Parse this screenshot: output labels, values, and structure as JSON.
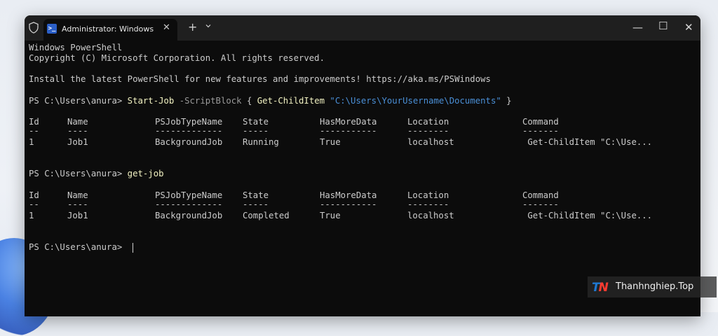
{
  "window": {
    "tab_title": "Administrator: Windows PowerShell",
    "tab_icon_glyph": ">_",
    "new_tab_label": "+",
    "close_tab_label": "✕",
    "minimize_label": "—",
    "maximize_label": "☐",
    "close_label": "✕"
  },
  "terminal": {
    "lines": [
      "Windows PowerShell",
      "Copyright (C) Microsoft Corporation. All rights reserved.",
      "Install the latest PowerShell for new features and improvements! https://aka.ms/PSWindows"
    ],
    "prompt": "PS C:\\Users\\anura> ",
    "command1": {
      "cmdlet": "Start-Job",
      "param": " -ScriptBlock",
      "brace_open": " { ",
      "inner": "Get-ChildItem",
      "string": " \"C:\\Users\\YourUsername\\Documents\"",
      "brace_close": " }"
    },
    "table1": {
      "headers": [
        "Id",
        "Name",
        "PSJobTypeName",
        "State",
        "HasMoreData",
        "Location",
        "Command"
      ],
      "underlines": [
        "--",
        "----",
        "-------------",
        "-----",
        "-----------",
        "--------",
        "-------"
      ],
      "row": [
        "1",
        "Job1",
        "BackgroundJob",
        "Running",
        "True",
        "localhost",
        " Get-ChildItem \"C:\\Use..."
      ]
    },
    "command2": "get-job",
    "table2": {
      "headers": [
        "Id",
        "Name",
        "PSJobTypeName",
        "State",
        "HasMoreData",
        "Location",
        "Command"
      ],
      "underlines": [
        "--",
        "----",
        "-------------",
        "-----",
        "-----------",
        "--------",
        "-------"
      ],
      "row": [
        "1",
        "Job1",
        "BackgroundJob",
        "Completed",
        "True",
        "localhost",
        " Get-ChildItem \"C:\\Use..."
      ]
    }
  },
  "watermark": {
    "logo_t": "T",
    "logo_n": "N",
    "text": "Thanhnghiep.Top"
  },
  "colors": {
    "terminal_bg": "#0c0c0c",
    "titlebar_bg": "#1f1f1f",
    "cmdlet": "#f2f2c2",
    "parameter": "#9a9a9a",
    "string": "#4a8fd6"
  }
}
